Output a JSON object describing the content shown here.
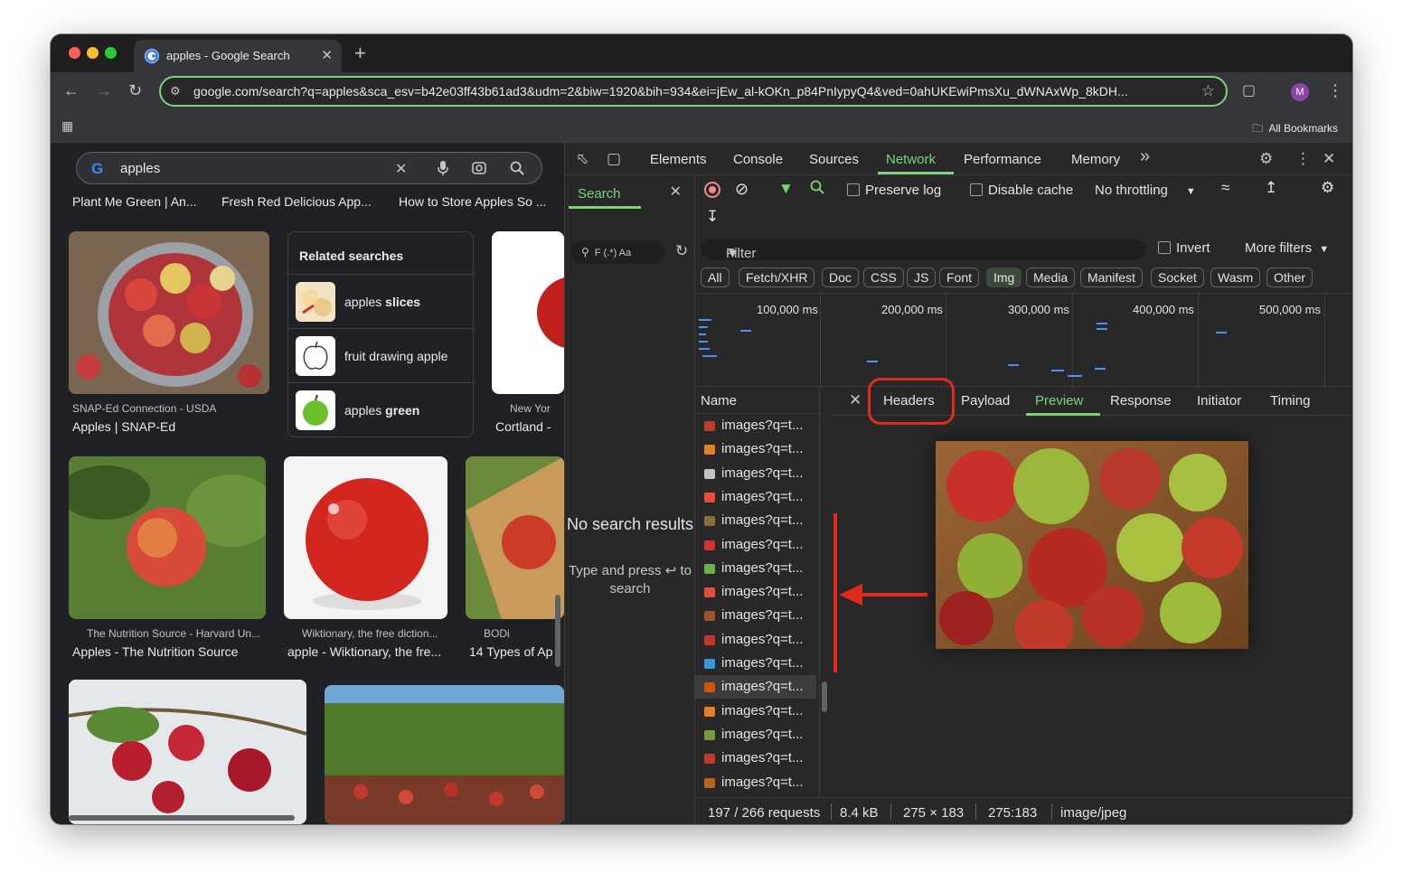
{
  "browser": {
    "tab_title": "apples - Google Search",
    "tab_close": "✕",
    "new_tab": "+",
    "url": "google.com/search?q=apples&sca_esv=b42e03ff43b61ad3&udm=2&biw=1920&bih=934&ei=jEw_al-kOKn_p84PnIypyQ4&ved=0ahUKEwiPmsXu_dWNAxWp_8kDH...",
    "avatar_letter": "M",
    "all_bookmarks": "All Bookmarks"
  },
  "google": {
    "logo": "G",
    "query": "apples",
    "chips": [
      "Plant Me Green | An...",
      "Fresh Red Delicious App...",
      "How to Store Apples So ..."
    ],
    "results": [
      {
        "source": "SNAP-Ed Connection - USDA",
        "title": "Apples | SNAP-Ed"
      },
      {
        "source": "New Yor",
        "title": "Cortland -"
      },
      {
        "source": "The Nutrition Source - Harvard Un...",
        "title": "Apples - The Nutrition Source"
      },
      {
        "source": "Wiktionary, the free diction...",
        "title": "apple - Wiktionary, the fre..."
      },
      {
        "source": "BODi",
        "title": "14 Types of Ap"
      }
    ],
    "related": {
      "heading": "Related searches",
      "items": [
        {
          "prefix": "apples ",
          "bold": "slices"
        },
        {
          "prefix": "fruit drawing apple",
          "bold": ""
        },
        {
          "prefix": "apples ",
          "bold": "green"
        }
      ]
    }
  },
  "devtools": {
    "tabs": [
      "Elements",
      "Console",
      "Sources",
      "Network",
      "Performance",
      "Memory"
    ],
    "more_tabs": "»",
    "search": {
      "title": "Search",
      "options": "F (.*) Aa",
      "empty_title": "No search results",
      "empty_sub": "Type and press ↩ to search"
    },
    "network": {
      "preserve_log": "Preserve log",
      "disable_cache": "Disable cache",
      "throttling": "No throttling",
      "filter_placeholder": "Filter",
      "invert": "Invert",
      "more_filters": "More filters",
      "type_filters": [
        "All",
        "Fetch/XHR",
        "Doc",
        "CSS",
        "JS",
        "Font",
        "Img",
        "Media",
        "Manifest",
        "Socket",
        "Wasm",
        "Other"
      ],
      "active_type": "Img",
      "timeline_labels": [
        "100,000 ms",
        "200,000 ms",
        "300,000 ms",
        "400,000 ms",
        "500,000 ms"
      ],
      "name_header": "Name",
      "requests": [
        "images?q=t...",
        "images?q=t...",
        "images?q=t...",
        "images?q=t...",
        "images?q=t...",
        "images?q=t...",
        "images?q=t...",
        "images?q=t...",
        "images?q=t...",
        "images?q=t...",
        "images?q=t...",
        "images?q=t...",
        "images?q=t...",
        "images?q=t...",
        "images?q=t...",
        "images?q=t..."
      ],
      "selected_index": 11,
      "detail_tabs": [
        "Headers",
        "Payload",
        "Preview",
        "Response",
        "Initiator",
        "Timing"
      ],
      "active_detail_tab": "Preview",
      "status": {
        "requests": "197 / 266 requests",
        "size": "8.4 kB",
        "dimensions": "275 × 183",
        "ratio": "275:183",
        "mime": "image/jpeg"
      }
    }
  },
  "colors": {
    "accent_green": "#7cd37c",
    "annotation_red": "#e02a20",
    "record_red": "#f28b82",
    "timeline_blue": "#4e8df5"
  }
}
